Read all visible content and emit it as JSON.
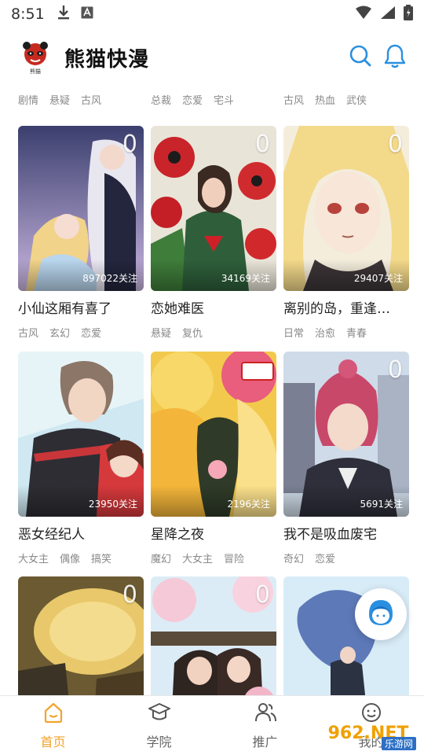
{
  "status_bar": {
    "time": "8:51"
  },
  "header": {
    "title": "熊猫快漫",
    "logo_text": "熊猫"
  },
  "partial_row": [
    {
      "tags": [
        "剧情",
        "悬疑",
        "古风"
      ]
    },
    {
      "tags": [
        "总裁",
        "恋爱",
        "宅斗"
      ]
    },
    {
      "tags": [
        "古风",
        "热血",
        "武侠"
      ]
    }
  ],
  "comics": [
    {
      "title": "小仙这厢有喜了",
      "follows": "897022关注",
      "badge": "0",
      "tags": [
        "古风",
        "玄幻",
        "恋爱"
      ]
    },
    {
      "title": "恋她难医",
      "follows": "34169关注",
      "badge": "0",
      "tags": [
        "悬疑",
        "复仇"
      ]
    },
    {
      "title": "离别的岛，重逢…",
      "follows": "29407关注",
      "badge": "0",
      "tags": [
        "日常",
        "治愈",
        "青春"
      ]
    },
    {
      "title": "恶女经纪人",
      "follows": "23950关注",
      "badge": "",
      "tags": [
        "大女主",
        "偶像",
        "搞笑"
      ]
    },
    {
      "title": "星降之夜",
      "follows": "2196关注",
      "badge": "",
      "tags": [
        "魔幻",
        "大女主",
        "冒险"
      ]
    },
    {
      "title": "我不是吸血废宅",
      "follows": "5691关注",
      "badge": "0",
      "tags": [
        "奇幻",
        "恋爱"
      ]
    },
    {
      "title": "",
      "follows": "",
      "badge": "0",
      "tags": []
    },
    {
      "title": "",
      "follows": "",
      "badge": "0",
      "tags": []
    },
    {
      "title": "",
      "follows": "",
      "badge": "",
      "tags": []
    }
  ],
  "bottom_nav": [
    {
      "label": "首页",
      "active": true
    },
    {
      "label": "学院",
      "active": false
    },
    {
      "label": "推广",
      "active": false
    },
    {
      "label": "我的",
      "active": false
    }
  ],
  "watermark": {
    "text": "962.NET",
    "sub": "乐游网"
  },
  "colors": {
    "accent": "#f2a32c",
    "icon_blue": "#2a8fe0"
  }
}
